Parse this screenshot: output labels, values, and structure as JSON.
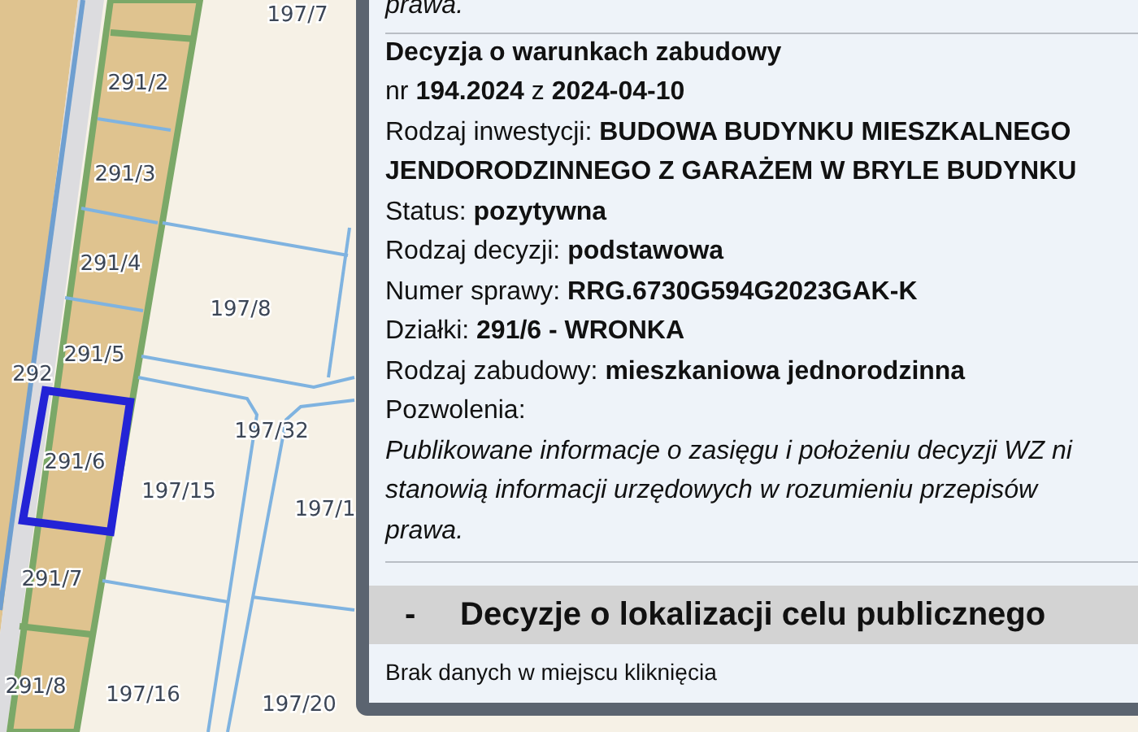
{
  "map": {
    "parcels": [
      {
        "label": "197/7",
        "selected": false
      },
      {
        "label": "291/2",
        "selected": false
      },
      {
        "label": "291/3",
        "selected": false
      },
      {
        "label": "291/4",
        "selected": false
      },
      {
        "label": "197/8",
        "selected": false
      },
      {
        "label": "291/5",
        "selected": false
      },
      {
        "label": "292",
        "selected": false
      },
      {
        "label": "197/32",
        "selected": false
      },
      {
        "label": "291/6",
        "selected": true
      },
      {
        "label": "197/15",
        "selected": false
      },
      {
        "label": "197/1",
        "selected": false
      },
      {
        "label": "291/7",
        "selected": false
      },
      {
        "label": "291/8",
        "selected": false
      },
      {
        "label": "197/16",
        "selected": false
      },
      {
        "label": "197/20",
        "selected": false
      }
    ]
  },
  "popup": {
    "previous_tail": "prawa.",
    "decision": {
      "title": "Decyzja o warunkach zabudowy",
      "number": {
        "prefix": "nr",
        "value": "194.2024",
        "joiner": "z",
        "date": "2024-04-10"
      },
      "fields": [
        {
          "label": "Rodzaj inwestycji:",
          "value": "BUDOWA BUDYNKU MIESZKALNEGO",
          "continuation": "JENDORODZINNEGO Z GARAŻEM W BRYLE BUDYNKU"
        },
        {
          "label": "Status:",
          "value": "pozytywna"
        },
        {
          "label": "Rodzaj decyzji:",
          "value": "podstawowa"
        },
        {
          "label": "Numer sprawy:",
          "value": "RRG.6730G594G2023GAK-K"
        },
        {
          "label": "Działki:",
          "value": "291/6 - WRONKA"
        },
        {
          "label": "Rodzaj zabudowy:",
          "value": "mieszkaniowa jednorodzinna"
        },
        {
          "label": "Pozwolenia:"
        }
      ],
      "notice_lines": [
        "Publikowane informacje o zasięgu i położeniu decyzji WZ ni",
        "stanowią informacji urzędowych w rozumieniu przepisów",
        "prawa."
      ]
    },
    "section": {
      "toggle": "-",
      "title": "Decyzje o lokalizacji celu publicznego",
      "expanded": true,
      "empty_text": "Brak danych w miejscu kliknięcia"
    }
  }
}
